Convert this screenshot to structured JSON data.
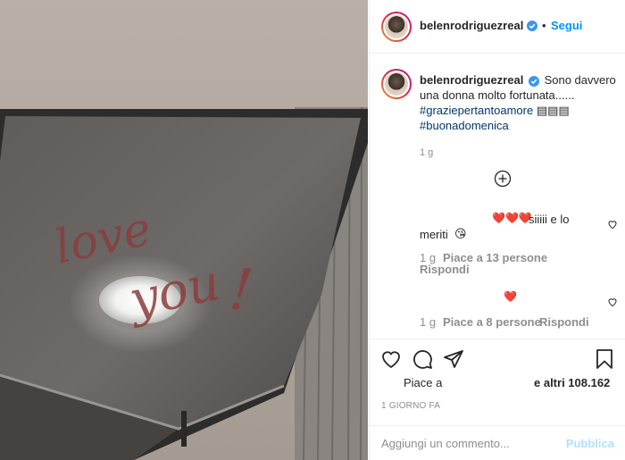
{
  "post": {
    "username": "belenrodriguezreal",
    "separator": "•",
    "follow_label": "Segui"
  },
  "caption": {
    "username": "belenrodriguezreal",
    "text": "Sono davvero una donna molto fortunata......",
    "hashtag1": "#graziepertantoamore",
    "hashtag1_suffix": "▤▤▤",
    "hashtag2": "#buonadomenica",
    "time": "1 g"
  },
  "comments": [
    {
      "lead": "❤️❤️❤️",
      "text_line1": "siiiii e lo",
      "text_line2": "meriti",
      "emoji": "😘",
      "time": "1 g",
      "likes": "Piace a 13 persone",
      "reply": "Rispondi"
    },
    {
      "lead": "❤️",
      "time": "1 g",
      "likes": "Piace a 8 persone",
      "reply": "Rispondi"
    }
  ],
  "likes": {
    "prefix": "Piace a",
    "suffix": "e altri 108.162"
  },
  "time_ago": "1 GIORNO FA",
  "add_comment": {
    "placeholder": "Aggiungi un commento...",
    "publish": "Pubblica"
  },
  "photo": {
    "handwriting_line1": "love",
    "handwriting_line2": "you",
    "handwriting_mark": "!"
  },
  "colors": {
    "link": "#0095f6",
    "hashtag": "#00376b",
    "muted": "#8e8e8e",
    "heart": "#ed4956",
    "lipstick": "#8a3d3d"
  },
  "icons": [
    "verified-icon",
    "add-circle-icon",
    "heart-icon",
    "comment-icon",
    "share-icon",
    "bookmark-icon"
  ]
}
